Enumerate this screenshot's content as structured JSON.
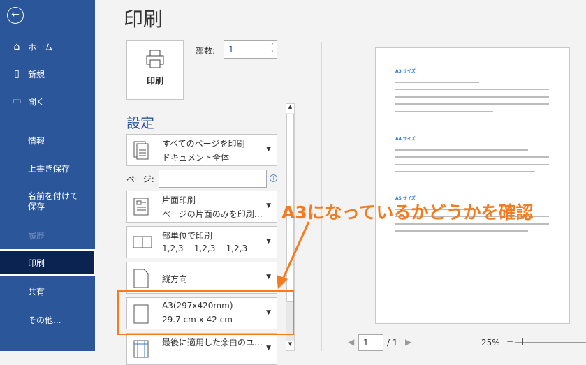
{
  "sidebar": {
    "items": [
      {
        "label": "ホーム"
      },
      {
        "label": "新規"
      },
      {
        "label": "開く"
      },
      {
        "label": "情報"
      },
      {
        "label": "上書き保存"
      },
      {
        "label": "名前を付けて保存"
      },
      {
        "label": "履歴"
      },
      {
        "label": "印刷"
      },
      {
        "label": "共有"
      },
      {
        "label": "その他..."
      }
    ]
  },
  "main": {
    "title": "印刷",
    "print_button": "印刷",
    "copies_label": "部数:",
    "copies_value": "1",
    "settings_heading": "設定",
    "pages_label": "ページ:",
    "pages_value": "",
    "settings": [
      {
        "line1": "すべてのページを印刷",
        "line2": "ドキュメント全体"
      },
      {
        "line1": "片面印刷",
        "line2": "ページの片面のみを印刷…"
      },
      {
        "line1": "部単位で印刷",
        "line2": "1,2,3    1,2,3    1,2,3"
      },
      {
        "line1": "縦方向",
        "line2": ""
      },
      {
        "line1": "A3(297x420mm)",
        "line2": "29.7 cm x 42 cm"
      },
      {
        "line1": "最後に適用した余白のユ…",
        "line2": ""
      }
    ]
  },
  "preview": {
    "headings": [
      "A3 サイズ",
      "A4 サイズ",
      "A5 サイズ"
    ],
    "page_current": "1",
    "page_total": "/ 1",
    "zoom": "25%"
  },
  "annotation": {
    "text": "A3になっているかどうかを確認",
    "color": "#f47b20"
  }
}
